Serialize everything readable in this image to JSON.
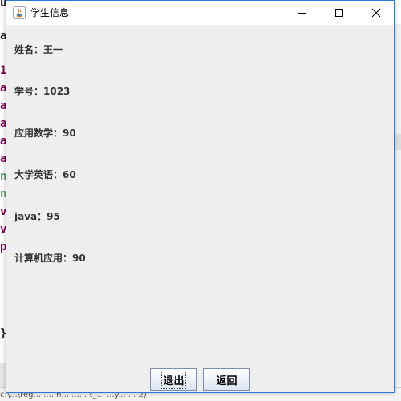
{
  "background_editor": {
    "lines": [
      {
        "text": "u",
        "color": "#222222"
      },
      {
        "text": "a",
        "color": "#222222"
      },
      {
        "text": "1",
        "color": "#7f0055"
      },
      {
        "text": "a",
        "color": "#7f0055"
      },
      {
        "text": "a",
        "color": "#7f0055"
      },
      {
        "text": "a",
        "color": "#7f0055"
      },
      {
        "text": "a",
        "color": "#7f0055"
      },
      {
        "text": "a",
        "color": "#7f0055"
      },
      {
        "text": "n",
        "color": "#5a9a6a"
      },
      {
        "text": "n",
        "color": "#5a9a6a"
      },
      {
        "text": "v",
        "color": "#7f0055"
      },
      {
        "text": "v",
        "color": "#7f0055"
      },
      {
        "text": "p",
        "color": "#7f0055"
      },
      {
        "text": "}",
        "color": "#222222"
      }
    ],
    "status_text": "c:\\...\\reg...   .....h...  ...... t_...   ...y...   ...                                        2)"
  },
  "window": {
    "title": "学生信息",
    "border_color": "#2a78d6"
  },
  "student": {
    "name": "姓名：王一",
    "id": "学号：1023",
    "math": "应用数学：90",
    "english": "大学英语：60",
    "java": "java：95",
    "computer": "计算机应用：90"
  },
  "buttons": {
    "exit_label": "退出",
    "back_label": "返回"
  },
  "icons": {
    "app": "java-app-icon",
    "minimize": "minimize-icon",
    "maximize": "maximize-icon",
    "close": "close-icon"
  }
}
